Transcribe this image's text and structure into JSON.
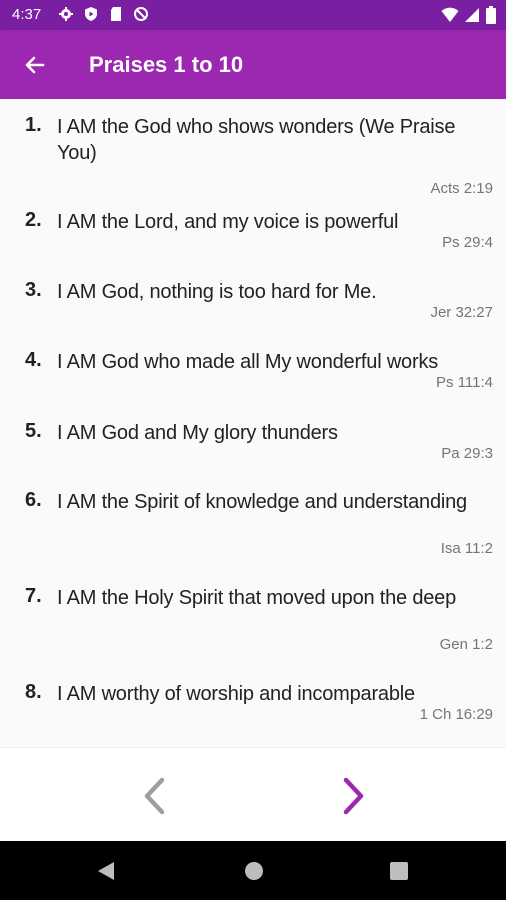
{
  "status_bar": {
    "time": "4:37"
  },
  "app_bar": {
    "title": "Praises 1 to 10",
    "back_icon": "arrow-left-icon"
  },
  "praises": [
    {
      "number": "1.",
      "text": "I AM the God who shows wonders (We Praise You)",
      "reference": "Acts 2:19"
    },
    {
      "number": "2.",
      "text": "I AM the Lord, and my voice is powerful",
      "reference": "Ps 29:4"
    },
    {
      "number": "3.",
      "text": "I AM God, nothing is too hard for Me.",
      "reference": "Jer 32:27"
    },
    {
      "number": "4.",
      "text": "I AM God who made all My wonderful works",
      "reference": "Ps 111:4"
    },
    {
      "number": "5.",
      "text": "I AM God and My glory thunders",
      "reference": "Pa 29:3"
    },
    {
      "number": "6.",
      "text": "I AM the Spirit of knowledge and understanding",
      "reference": "Isa 11:2"
    },
    {
      "number": "7.",
      "text": "I AM the Holy Spirit that moved upon the deep",
      "reference": "Gen 1:2"
    },
    {
      "number": "8.",
      "text": "I AM worthy of worship and incomparable",
      "reference": "1 Ch 16:29"
    }
  ],
  "navigation": {
    "prev_icon": "chevron-left-icon",
    "next_icon": "chevron-right-icon"
  },
  "colors": {
    "status_bar": "#7b1fa2",
    "app_bar": "#9c27b0",
    "next_arrow": "#9c27b0",
    "prev_arrow": "#9e9e9e"
  }
}
